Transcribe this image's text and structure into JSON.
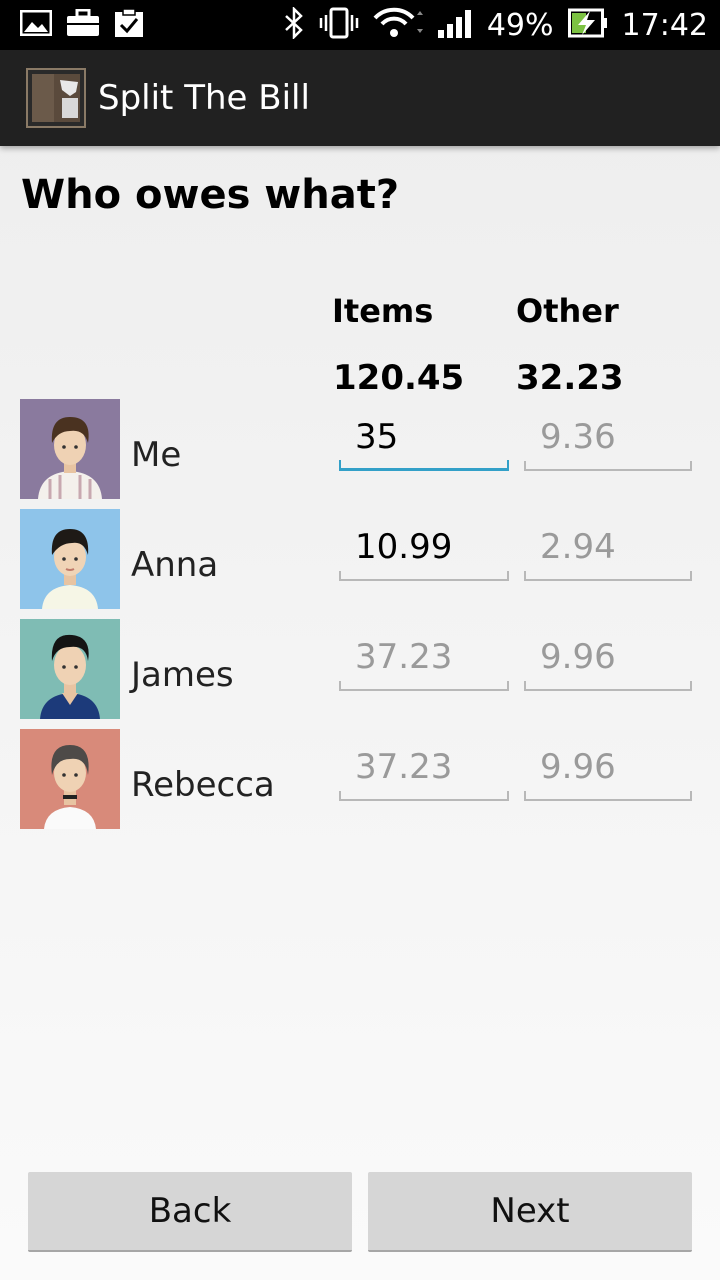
{
  "status_bar": {
    "battery": "49%",
    "time": "17:42"
  },
  "app": {
    "title": "Split The Bill"
  },
  "page": {
    "heading": "Who owes what?",
    "columns": {
      "items": "Items",
      "other": "Other"
    },
    "totals": {
      "items": "120.45",
      "other": "32.23"
    }
  },
  "people": [
    {
      "name": "Me",
      "items_value": "35",
      "items_placeholder": "",
      "other_value": "",
      "other_placeholder": "9.36"
    },
    {
      "name": "Anna",
      "items_value": "10.99",
      "items_placeholder": "",
      "other_value": "",
      "other_placeholder": "2.94"
    },
    {
      "name": "James",
      "items_value": "",
      "items_placeholder": "37.23",
      "other_value": "",
      "other_placeholder": "9.96"
    },
    {
      "name": "Rebecca",
      "items_value": "",
      "items_placeholder": "37.23",
      "other_value": "",
      "other_placeholder": "9.96"
    }
  ],
  "buttons": {
    "back": "Back",
    "next": "Next"
  },
  "colors": {
    "accent": "#33a0c8",
    "action_bar": "#212121",
    "status_bar": "#000000"
  },
  "icons": [
    "image-icon",
    "briefcase-icon",
    "clipboard-check-icon",
    "bluetooth-icon",
    "vibrate-icon",
    "wifi-icon",
    "signal-icon",
    "battery-charging-icon",
    "app-icon"
  ]
}
